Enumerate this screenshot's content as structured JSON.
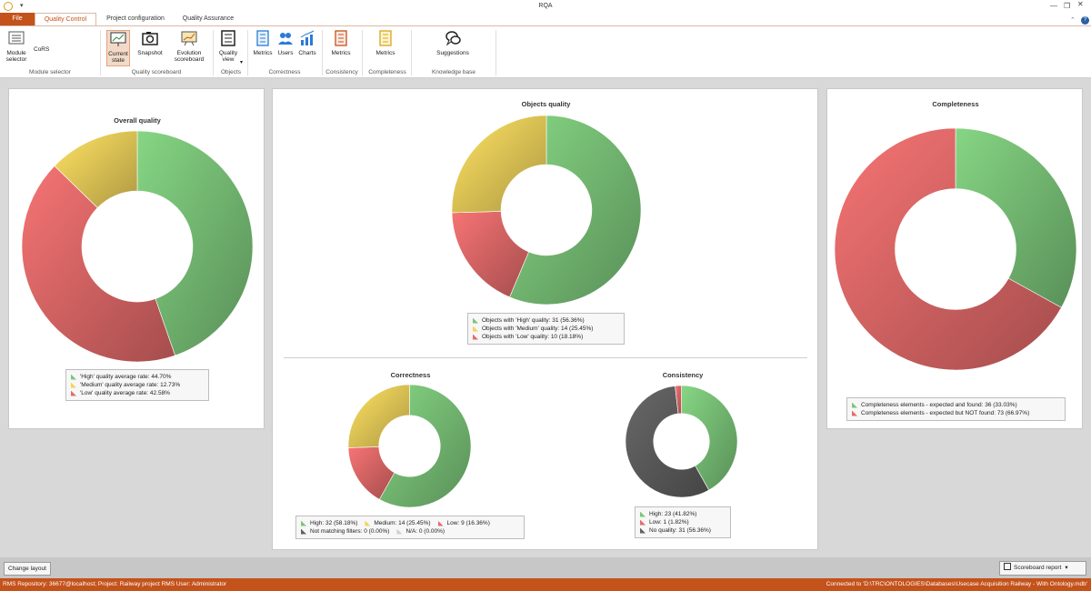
{
  "window": {
    "title": "RQA"
  },
  "tabs": [
    {
      "label": "File"
    },
    {
      "label": "Quality Control"
    },
    {
      "label": "Project configuration"
    },
    {
      "label": "Quality Assurance"
    }
  ],
  "ribbon": {
    "module_selector": {
      "label": "Module selector",
      "cors": "CoRS",
      "group": "Module selector"
    },
    "scoreboard": {
      "current": "Current state",
      "snapshot": "Snapshot",
      "evolution": "Evolution scoreboard",
      "group": "Quality scoreboard"
    },
    "objects": {
      "quality_view": "Quality view",
      "group": "Objects"
    },
    "correctness": {
      "metrics": "Metrics",
      "users": "Users",
      "charts": "Charts",
      "group": "Correctness"
    },
    "consistency": {
      "metrics": "Metrics",
      "group": "Consistency"
    },
    "completeness": {
      "metrics": "Metrics",
      "group": "Completeness"
    },
    "knowledge": {
      "suggestions": "Suggestions",
      "group": "Knowledge base"
    }
  },
  "colors": {
    "high": "#7cc67a",
    "medium": "#f2d35c",
    "low": "#e56b6b",
    "grey": "#606060",
    "lightgrey": "#d0d0d0",
    "accent": "#c4521b"
  },
  "overall": {
    "title": "Overall quality",
    "chart_data": {
      "type": "pie",
      "slices": [
        {
          "label": "'High' quality average rate: 44.70%",
          "value": 44.7,
          "color": "high"
        },
        {
          "label": "'Low' quality average rate: 42.58%",
          "value": 42.58,
          "color": "low"
        },
        {
          "label": "'Medium' quality average rate: 12.73%",
          "value": 12.73,
          "color": "medium"
        }
      ],
      "legend": [
        {
          "label": "'High' quality average rate: 44.70%",
          "color": "high"
        },
        {
          "label": "'Medium' quality average rate: 12.73%",
          "color": "medium"
        },
        {
          "label": "'Low' quality average rate: 42.58%",
          "color": "low"
        }
      ]
    }
  },
  "objects_quality": {
    "title": "Objects quality",
    "chart_data": {
      "type": "pie",
      "slices": [
        {
          "label": "Objects with 'High' quality: 31 (56.36%)",
          "value": 31,
          "color": "high"
        },
        {
          "label": "Objects with 'Low' quality: 10 (18.18%)",
          "value": 10,
          "color": "low"
        },
        {
          "label": "Objects with 'Medium' quality: 14 (25.45%)",
          "value": 14,
          "color": "medium"
        }
      ],
      "legend": [
        {
          "label": "Objects with 'High' quality: 31 (56.36%)",
          "color": "high"
        },
        {
          "label": "Objects with 'Medium' quality: 14 (25.45%)",
          "color": "medium"
        },
        {
          "label": "Objects with 'Low' quality: 10 (18.18%)",
          "color": "low"
        }
      ]
    }
  },
  "correctness": {
    "title": "Correctness",
    "chart_data": {
      "type": "pie",
      "slices": [
        {
          "label": "High: 32 (58.18%)",
          "value": 32,
          "color": "high"
        },
        {
          "label": "Low: 9 (16.36%)",
          "value": 9,
          "color": "low"
        },
        {
          "label": "Medium: 14 (25.45%)",
          "value": 14,
          "color": "medium"
        }
      ],
      "legend": [
        {
          "label": "High: 32 (58.18%)",
          "color": "high"
        },
        {
          "label": "Medium: 14 (25.45%)",
          "color": "medium"
        },
        {
          "label": "Low: 9 (16.36%)",
          "color": "low"
        },
        {
          "label": "Not matching filters: 0 (0.00%)",
          "color": "grey"
        },
        {
          "label": "N/A: 0 (0.00%)",
          "color": "lightgrey"
        }
      ]
    }
  },
  "consistency": {
    "title": "Consistency",
    "chart_data": {
      "type": "pie",
      "slices": [
        {
          "label": "High: 23 (41.82%)",
          "value": 23,
          "color": "high"
        },
        {
          "label": "No quality: 31 (56.36%)",
          "value": 31,
          "color": "grey"
        },
        {
          "label": "Low: 1 (1.82%)",
          "value": 1,
          "color": "low"
        }
      ],
      "legend": [
        {
          "label": "High: 23 (41.82%)",
          "color": "high"
        },
        {
          "label": "Low: 1 (1.82%)",
          "color": "low"
        },
        {
          "label": "No quality: 31 (56.36%)",
          "color": "grey"
        }
      ]
    }
  },
  "completeness": {
    "title": "Completeness",
    "chart_data": {
      "type": "pie",
      "slices": [
        {
          "label": "Completeness elements - expected and found: 36 (33.03%)",
          "value": 36,
          "color": "high"
        },
        {
          "label": "Completeness elements - expected but NOT found: 73 (66.97%)",
          "value": 73,
          "color": "low"
        }
      ],
      "legend": [
        {
          "label": "Completeness elements - expected and found: 36 (33.03%)",
          "color": "high"
        },
        {
          "label": "Completeness elements - expected but NOT found: 73 (66.97%)",
          "color": "low"
        }
      ]
    }
  },
  "bottom": {
    "change_layout": "Change layout",
    "scoreboard_report": "Scoreboard report"
  },
  "status": {
    "left": "RMS Repository: 36677@localhost; Project: Railway project    RMS User: Administrator",
    "right": "Connected to 'D:\\TRC\\ONTOLOGIES\\Databases\\Usecase Acquisition Railway - With Ontology.mdb'"
  }
}
